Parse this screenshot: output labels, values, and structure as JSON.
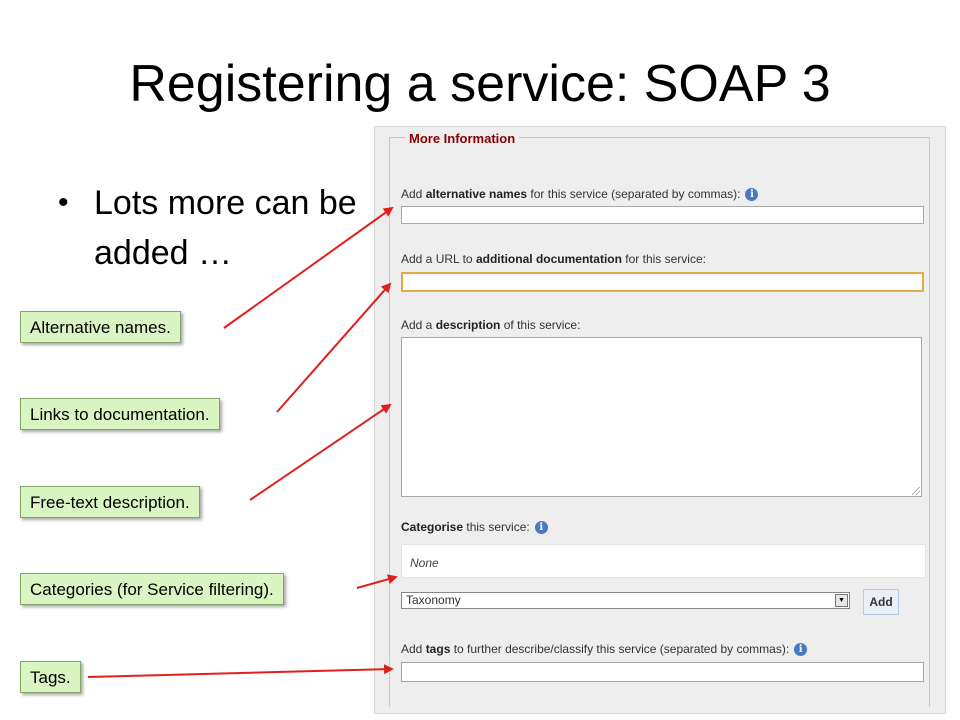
{
  "slide": {
    "title": "Registering a service: SOAP 3",
    "bullet": "Lots more can be added …"
  },
  "form": {
    "legend": "More Information",
    "alt_names": {
      "prefix": "Add ",
      "bold": "alternative names",
      "suffix": " for this service (separated by commas):",
      "value": ""
    },
    "doc_url": {
      "prefix": "Add a URL to ",
      "bold": "additional documentation",
      "suffix": " for this service:",
      "value": ""
    },
    "description": {
      "prefix": "Add a ",
      "bold": "description",
      "suffix": " of this service:",
      "value": ""
    },
    "categorise": {
      "bold": "Categorise",
      "suffix": " this service:",
      "current": "None",
      "select_value": "Taxonomy",
      "add_label": "Add"
    },
    "tags": {
      "prefix": "Add ",
      "bold": "tags",
      "suffix": " to further describe/classify this service (separated by commas):",
      "value": ""
    },
    "info_icon_glyph": "i"
  },
  "callouts": {
    "alt_names": "Alternative names.",
    "docs": "Links to documentation.",
    "description": "Free-text description.",
    "categories": "Categories (for Service filtering).",
    "tags": "Tags."
  },
  "colors": {
    "legend": "#8b0000",
    "callout_bg": "#d8f5c2",
    "arrow": "#e0201c",
    "focus_border": "#e1a948",
    "panel_bg": "#eeeeee"
  }
}
